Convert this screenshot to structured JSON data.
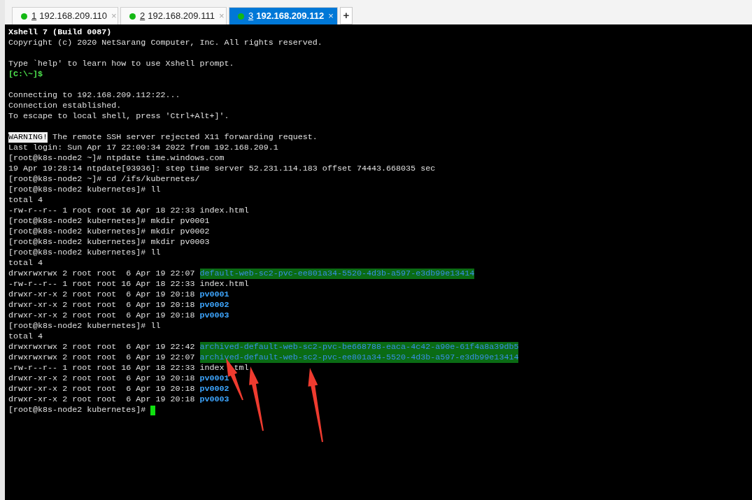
{
  "tabs": [
    {
      "number": "1",
      "label": "192.168.209.110",
      "close": "×",
      "connected": true,
      "selected": false
    },
    {
      "number": "2",
      "label": "192.168.209.111",
      "close": "×",
      "connected": true,
      "selected": false
    },
    {
      "number": "3",
      "label": "192.168.209.112",
      "close": "×",
      "connected": true,
      "selected": true
    }
  ],
  "new_tab": "+",
  "terminal": {
    "lines": [
      {
        "kind": "text",
        "segments": [
          {
            "kind": "bold",
            "text": "Xshell 7 (Build 0087)"
          }
        ]
      },
      {
        "kind": "text",
        "segments": [
          {
            "kind": "plain",
            "text": "Copyright (c) 2020 NetSarang Computer, Inc. All rights reserved."
          }
        ]
      },
      {
        "kind": "blank"
      },
      {
        "kind": "text",
        "segments": [
          {
            "kind": "plain",
            "text": "Type `help' to learn how to use Xshell prompt."
          }
        ]
      },
      {
        "kind": "text",
        "segments": [
          {
            "kind": "prompt",
            "text": "[C:\\~]$"
          }
        ]
      },
      {
        "kind": "blank"
      },
      {
        "kind": "text",
        "segments": [
          {
            "kind": "plain",
            "text": "Connecting to 192.168.209.112:22..."
          }
        ]
      },
      {
        "kind": "text",
        "segments": [
          {
            "kind": "plain",
            "text": "Connection established."
          }
        ]
      },
      {
        "kind": "text",
        "segments": [
          {
            "kind": "plain",
            "text": "To escape to local shell, press 'Ctrl+Alt+]'."
          }
        ]
      },
      {
        "kind": "blank"
      },
      {
        "kind": "text",
        "segments": [
          {
            "kind": "warning",
            "text": "WARNING!"
          },
          {
            "kind": "plain",
            "text": " The remote SSH server rejected X11 forwarding request."
          }
        ]
      },
      {
        "kind": "text",
        "segments": [
          {
            "kind": "plain",
            "text": "Last login: Sun Apr 17 22:00:34 2022 from 192.168.209.1"
          }
        ]
      },
      {
        "kind": "text",
        "segments": [
          {
            "kind": "plain",
            "text": "[root@k8s-node2 ~]# ntpdate time.windows.com"
          }
        ]
      },
      {
        "kind": "text",
        "segments": [
          {
            "kind": "plain",
            "text": "19 Apr 19:28:14 ntpdate[93936]: step time server 52.231.114.183 offset 74443.668035 sec"
          }
        ]
      },
      {
        "kind": "text",
        "segments": [
          {
            "kind": "plain",
            "text": "[root@k8s-node2 ~]# cd /ifs/kubernetes/"
          }
        ]
      },
      {
        "kind": "text",
        "segments": [
          {
            "kind": "plain",
            "text": "[root@k8s-node2 kubernetes]# ll"
          }
        ]
      },
      {
        "kind": "text",
        "segments": [
          {
            "kind": "plain",
            "text": "total 4"
          }
        ]
      },
      {
        "kind": "text",
        "segments": [
          {
            "kind": "plain",
            "text": "-rw-r--r-- 1 root root 16 Apr 18 22:33 index.html"
          }
        ]
      },
      {
        "kind": "text",
        "segments": [
          {
            "kind": "plain",
            "text": "[root@k8s-node2 kubernetes]# mkdir pv0001"
          }
        ]
      },
      {
        "kind": "text",
        "segments": [
          {
            "kind": "plain",
            "text": "[root@k8s-node2 kubernetes]# mkdir pv0002"
          }
        ]
      },
      {
        "kind": "text",
        "segments": [
          {
            "kind": "plain",
            "text": "[root@k8s-node2 kubernetes]# mkdir pv0003"
          }
        ]
      },
      {
        "kind": "text",
        "segments": [
          {
            "kind": "plain",
            "text": "[root@k8s-node2 kubernetes]# ll"
          }
        ]
      },
      {
        "kind": "text",
        "segments": [
          {
            "kind": "plain",
            "text": "total 4"
          }
        ]
      },
      {
        "kind": "text",
        "segments": [
          {
            "kind": "plain",
            "text": "drwxrwxrwx 2 root root  6 Apr 19 22:07 "
          },
          {
            "kind": "shared_dir",
            "text": "default-web-sc2-pvc-ee801a34-5520-4d3b-a597-e3db99e13414"
          }
        ]
      },
      {
        "kind": "text",
        "segments": [
          {
            "kind": "plain",
            "text": "-rw-r--r-- 1 root root 16 Apr 18 22:33 index.html"
          }
        ]
      },
      {
        "kind": "text",
        "segments": [
          {
            "kind": "plain",
            "text": "drwxr-xr-x 2 root root  6 Apr 19 20:18 "
          },
          {
            "kind": "dir",
            "text": "pv0001"
          }
        ]
      },
      {
        "kind": "text",
        "segments": [
          {
            "kind": "plain",
            "text": "drwxr-xr-x 2 root root  6 Apr 19 20:18 "
          },
          {
            "kind": "dir",
            "text": "pv0002"
          }
        ]
      },
      {
        "kind": "text",
        "segments": [
          {
            "kind": "plain",
            "text": "drwxr-xr-x 2 root root  6 Apr 19 20:18 "
          },
          {
            "kind": "dir",
            "text": "pv0003"
          }
        ]
      },
      {
        "kind": "text",
        "segments": [
          {
            "kind": "plain",
            "text": "[root@k8s-node2 kubernetes]# ll"
          }
        ]
      },
      {
        "kind": "text",
        "segments": [
          {
            "kind": "plain",
            "text": "total 4"
          }
        ]
      },
      {
        "kind": "text",
        "segments": [
          {
            "kind": "plain",
            "text": "drwxrwxrwx 2 root root  6 Apr 19 22:42 "
          },
          {
            "kind": "shared_dir",
            "text": "archived-default-web-sc2-pvc-be668788-eaca-4c42-a90e-61f4a8a39db5"
          }
        ]
      },
      {
        "kind": "text",
        "segments": [
          {
            "kind": "plain",
            "text": "drwxrwxrwx 2 root root  6 Apr 19 22:07 "
          },
          {
            "kind": "shared_dir",
            "text": "archived-default-web-sc2-pvc-ee801a34-5520-4d3b-a597-e3db99e13414"
          }
        ]
      },
      {
        "kind": "text",
        "segments": [
          {
            "kind": "plain",
            "text": "-rw-r--r-- 1 root root 16 Apr 18 22:33 index"
          },
          {
            "kind": "covered",
            "text": "tml"
          }
        ]
      },
      {
        "kind": "text",
        "segments": [
          {
            "kind": "plain",
            "text": "drwxr-xr-x 2 root root  6 Apr 19 20:18 "
          },
          {
            "kind": "dir",
            "text": "pv0001"
          }
        ]
      },
      {
        "kind": "text",
        "segments": [
          {
            "kind": "plain",
            "text": "drwxr-xr-x 2 root root  6 Apr 19 20:18 "
          },
          {
            "kind": "dir",
            "text": "pv0002"
          }
        ]
      },
      {
        "kind": "text",
        "segments": [
          {
            "kind": "plain",
            "text": "drwxr-xr-x 2 root root  6 Apr 19 20:18 "
          },
          {
            "kind": "dir",
            "text": "pv0003"
          }
        ]
      },
      {
        "kind": "text",
        "segments": [
          {
            "kind": "plain",
            "text": "[root@k8s-node2 kubernetes]# "
          },
          {
            "kind": "cursor"
          }
        ]
      }
    ]
  }
}
